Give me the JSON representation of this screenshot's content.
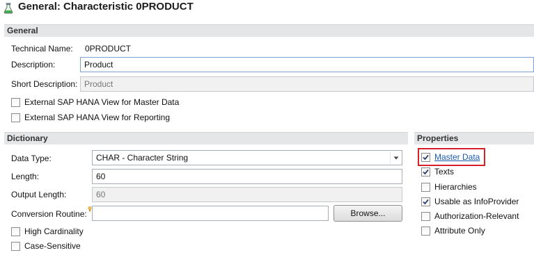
{
  "window": {
    "title": "General: Characteristic 0PRODUCT",
    "icon": "characteristic-flask-icon"
  },
  "general": {
    "header": "General",
    "technical_name_label": "Technical Name:",
    "technical_name_value": "0PRODUCT",
    "description_label": "Description:",
    "description_value": "Product",
    "short_description_label": "Short Description:",
    "short_description_value": "Product",
    "hana_master_label": "External SAP HANA View for Master Data",
    "hana_master_checked": false,
    "hana_reporting_label": "External SAP HANA View for Reporting",
    "hana_reporting_checked": false
  },
  "dictionary": {
    "header": "Dictionary",
    "data_type_label": "Data Type:",
    "data_type_value": "CHAR - Character String",
    "length_label": "Length:",
    "length_value": "60",
    "output_length_label": "Output Length:",
    "output_length_value": "60",
    "conversion_routine_label": "Conversion Routine:",
    "conversion_routine_value": "",
    "browse_label": "Browse...",
    "high_cardinality_label": "High Cardinality",
    "high_cardinality_checked": false,
    "case_sensitive_label": "Case-Sensitive",
    "case_sensitive_checked": false
  },
  "properties": {
    "header": "Properties",
    "items": [
      {
        "label": "Master Data",
        "checked": true,
        "link": true,
        "highlighted": true
      },
      {
        "label": "Texts",
        "checked": true,
        "link": false,
        "highlighted": false
      },
      {
        "label": "Hierarchies",
        "checked": false,
        "link": false,
        "highlighted": false
      },
      {
        "label": "Usable as InfoProvider",
        "checked": true,
        "link": false,
        "highlighted": false
      },
      {
        "label": "Authorization-Relevant",
        "checked": false,
        "link": false,
        "highlighted": false
      },
      {
        "label": "Attribute Only",
        "checked": false,
        "link": false,
        "highlighted": false
      }
    ]
  },
  "colors": {
    "section_header_bg": "#e4e6e8",
    "link": "#1a5bb0",
    "highlight": "#d9202a"
  }
}
